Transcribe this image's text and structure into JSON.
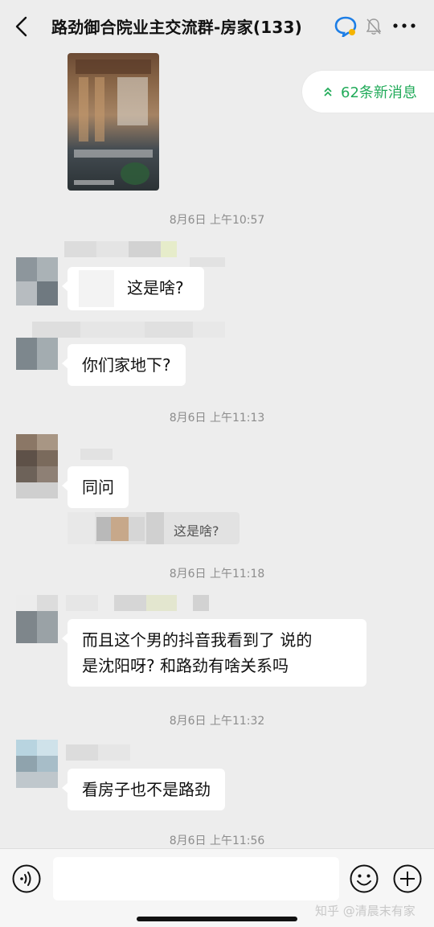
{
  "header": {
    "title": "路劲御合院业主交流群-房家(133)"
  },
  "new_messages": {
    "label": "62条新消息"
  },
  "messages": [
    {
      "time": "8月6日 上午10:57",
      "text": "这是啥?"
    },
    {
      "text": "你们家地下?"
    },
    {
      "time": "8月6日 上午11:13",
      "text": "同问",
      "quote": "这是啥?"
    },
    {
      "time": "8月6日 上午11:18",
      "lines": [
        "而且这个男的抖音我看到了 说的",
        "是沈阳呀? 和路劲有啥关系吗"
      ]
    },
    {
      "time": "8月6日 上午11:32",
      "text": "看房子也不是路劲"
    },
    {
      "time": "8月6日 上午11:56"
    }
  ],
  "input": {
    "placeholder": ""
  },
  "watermark": "知乎 @清晨末有家",
  "colors": {
    "background": "#ededed",
    "accent": "#22ab5a",
    "bubble": "#ffffff"
  }
}
